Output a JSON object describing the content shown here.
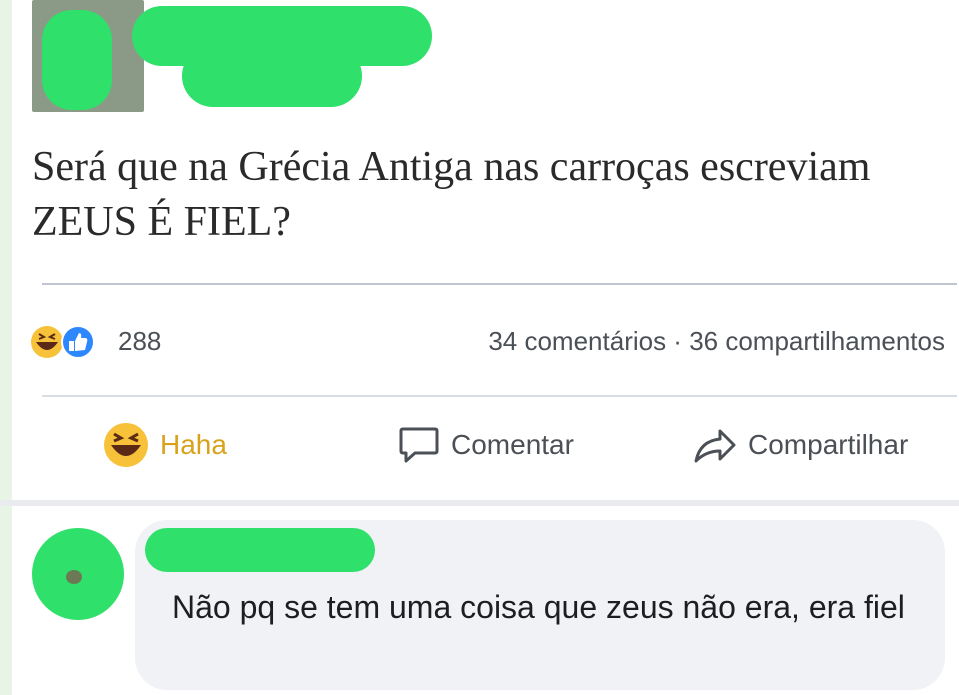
{
  "post": {
    "text": "Será que na Grécia Antiga nas carroças escreviam ZEUS É FIEL?"
  },
  "stats": {
    "reactions_count": "288",
    "comments_shares": "34 comentários · 36 compartilhamentos"
  },
  "actions": {
    "haha_label": "Haha",
    "comment_label": "Comentar",
    "share_label": "Compartilhar"
  },
  "comment": {
    "text": "Não pq se tem uma coisa que zeus não era, era fiel"
  },
  "colors": {
    "censor_green": "#2fe06a",
    "haha_yellow": "#f7c23a",
    "like_blue": "#2d88ff",
    "text_gray": "#4b4f56"
  },
  "icons": [
    "haha-reaction-icon",
    "like-reaction-icon",
    "comment-bubble-icon",
    "share-arrow-icon"
  ]
}
